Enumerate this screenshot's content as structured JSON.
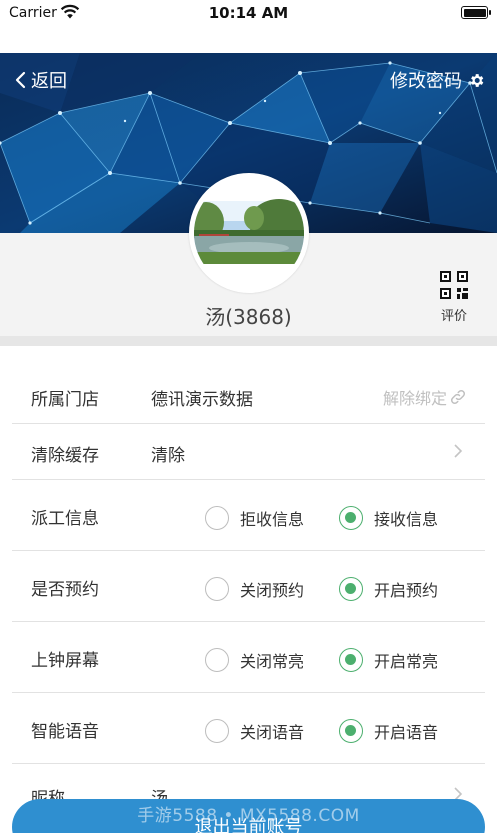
{
  "status_bar": {
    "carrier": "Carrier",
    "time": "10:14 AM"
  },
  "header": {
    "back_label": "返回",
    "change_password_label": "修改密码"
  },
  "profile": {
    "username": "汤(3868)",
    "rating_label": "评价"
  },
  "settings": {
    "store": {
      "label": "所属门店",
      "value": "德讯演示数据",
      "unbind_label": "解除绑定"
    },
    "cache": {
      "label": "清除缓存",
      "value": "清除"
    },
    "dispatch": {
      "label": "派工信息",
      "off_label": "拒收信息",
      "on_label": "接收信息",
      "selected": "on"
    },
    "booking": {
      "label": "是否预约",
      "off_label": "关闭预约",
      "on_label": "开启预约",
      "selected": "on"
    },
    "screen": {
      "label": "上钟屏幕",
      "off_label": "关闭常亮",
      "on_label": "开启常亮",
      "selected": "on"
    },
    "voice": {
      "label": "智能语音",
      "off_label": "关闭语音",
      "on_label": "开启语音",
      "selected": "on"
    },
    "nickname": {
      "label": "昵称",
      "value": "汤"
    }
  },
  "logout_label": "退出当前账号",
  "watermark": "手游5588 • MX5588.COM",
  "colors": {
    "accent_green": "#4caf6e",
    "logout_blue": "#2f8fd0",
    "header_dark": "#071a36"
  }
}
